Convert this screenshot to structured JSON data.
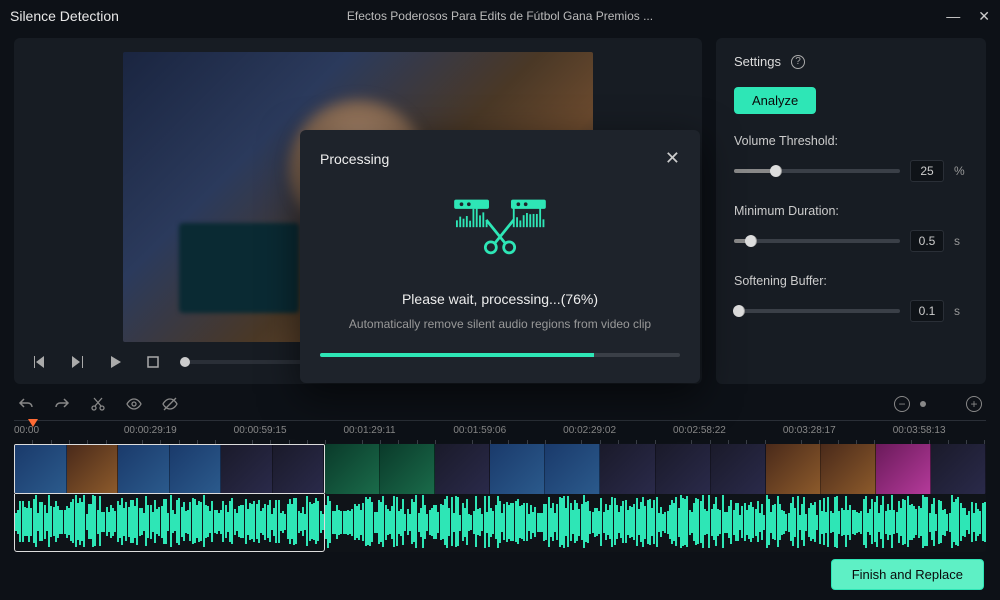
{
  "window": {
    "title": "Silence Detection",
    "document_title": "Efectos Poderosos Para Edits de Fútbol   Gana Premios ..."
  },
  "settings": {
    "header": "Settings",
    "analyze_label": "Analyze",
    "volume_threshold": {
      "label": "Volume Threshold:",
      "value": "25",
      "unit": "%",
      "pct": 25
    },
    "minimum_duration": {
      "label": "Minimum Duration:",
      "value": "0.5",
      "unit": "s",
      "pct": 10
    },
    "softening_buffer": {
      "label": "Softening Buffer:",
      "value": "0.1",
      "unit": "s",
      "pct": 3
    }
  },
  "modal": {
    "title": "Processing",
    "message": "Please wait, processing...(76%)",
    "subtitle": "Automatically remove silent audio regions from video clip",
    "progress_pct": 76
  },
  "timeline": {
    "ticks": [
      "00:00",
      "00:00:29:19",
      "00:00:59:15",
      "00:01:29:11",
      "00:01:59:06",
      "00:02:29:02",
      "00:02:58:22",
      "00:03:28:17",
      "00:03:58:13"
    ]
  },
  "footer": {
    "finish_label": "Finish and Replace"
  }
}
